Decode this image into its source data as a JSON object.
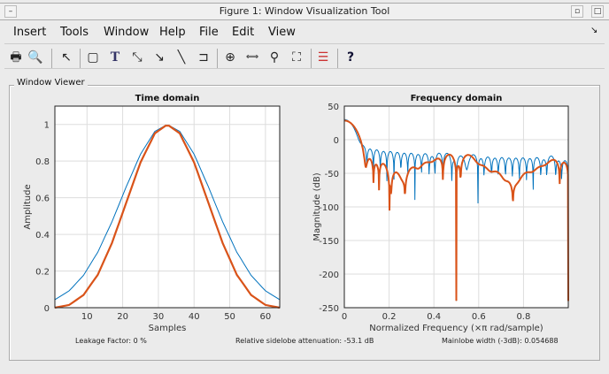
{
  "window": {
    "title": "Figure 1: Window Visualization Tool"
  },
  "menu": [
    "Insert",
    "Tools",
    "Window",
    "Help",
    "File",
    "Edit",
    "View"
  ],
  "toolbar": [
    "print-icon",
    "print-preview-icon",
    "pointer-icon",
    "rectangle-icon",
    "text-icon",
    "double-arrow-icon",
    "arrow-icon",
    "line-icon",
    "pin-icon",
    "zoom-in-icon",
    "pan-icon",
    "zoom-out-icon",
    "fit-icon",
    "legend-icon",
    "help-icon"
  ],
  "panel": {
    "title": "Window Viewer"
  },
  "stats": {
    "leakage": "Leakage Factor: 0 %",
    "sidelobe": "Relative sidelobe attenuation: -53.1 dB",
    "mainlobe": "Mainlobe width (-3dB): 0.054688"
  },
  "colors": {
    "series1": "#0072bd",
    "series2": "#d95319"
  },
  "chart_data": [
    {
      "type": "line",
      "title": "Time domain",
      "xlabel": "Samples",
      "ylabel": "Amplitude",
      "xlim": [
        1,
        64
      ],
      "ylim": [
        0,
        1.1
      ],
      "xticks": [
        10,
        20,
        30,
        40,
        50,
        60
      ],
      "yticks": [
        0,
        0.2,
        0.4,
        0.6,
        0.8,
        1
      ],
      "grid": true,
      "x": [
        1,
        5,
        9,
        13,
        17,
        21,
        25,
        29,
        32.5,
        36,
        40,
        44,
        48,
        52,
        56,
        60,
        64
      ],
      "series": [
        {
          "values": [
            0.044,
            0.092,
            0.176,
            0.302,
            0.469,
            0.66,
            0.838,
            0.962,
            1,
            0.962,
            0.838,
            0.66,
            0.469,
            0.302,
            0.176,
            0.092,
            0.044
          ]
        },
        {
          "values": [
            0,
            0.015,
            0.069,
            0.179,
            0.353,
            0.573,
            0.793,
            0.951,
            1,
            0.951,
            0.793,
            0.573,
            0.353,
            0.179,
            0.069,
            0.015,
            0
          ]
        }
      ]
    },
    {
      "type": "line",
      "title": "Frequency domain",
      "xlabel": "Normalized Frequency  (×π rad/sample)",
      "ylabel": "Magnitude (dB)",
      "xlim": [
        0,
        1
      ],
      "ylim": [
        -250,
        50
      ],
      "xticks": [
        0,
        0.2,
        0.4,
        0.6,
        0.8
      ],
      "yticks": [
        -250,
        -200,
        -150,
        -100,
        -50,
        0,
        50
      ],
      "grid": true,
      "series": [
        {
          "values": "20*log10|DFT| of time-domain series 1"
        },
        {
          "values": "20*log10|DFT| of time-domain series 2"
        }
      ]
    }
  ]
}
